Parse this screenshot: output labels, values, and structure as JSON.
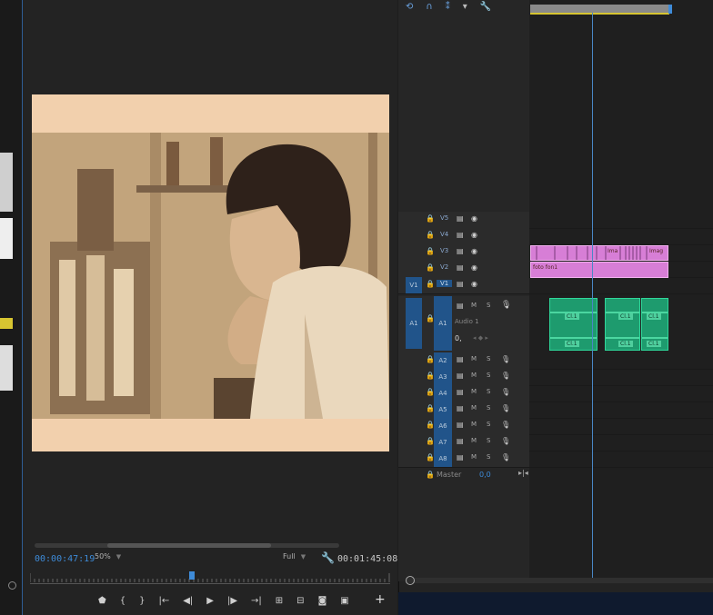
{
  "monitor": {
    "timecode_current": "00:00:47:19",
    "zoom": "50%",
    "resolution": "Full",
    "timecode_duration": "00:01:45:08"
  },
  "timeline": {
    "video_tracks": [
      {
        "name": "V5"
      },
      {
        "name": "V4"
      },
      {
        "name": "V3"
      },
      {
        "name": "V2"
      },
      {
        "name": "V1",
        "src": "V1"
      }
    ],
    "audio1": {
      "name": "A1",
      "src": "A1",
      "label": "Audio 1",
      "volume": "0,"
    },
    "audio_tracks": [
      "A2",
      "A3",
      "A4",
      "A5",
      "A6",
      "A7",
      "A8"
    ],
    "master": {
      "label": "Master",
      "value": "0,0"
    },
    "clips": {
      "v3_label_1": "Ima",
      "v3_label_2": "Imag",
      "v2_label": "foto fon1",
      "audio_label_1": "Cl.1",
      "audio_label_2": "Cl.1",
      "audio_label_3": "Cl.1"
    }
  },
  "colors": {
    "accent": "#3e8bd8",
    "video_clip": "#d77ed6",
    "audio_clip": "#1e9b6e",
    "frame_bg": "#f2d0ad"
  }
}
